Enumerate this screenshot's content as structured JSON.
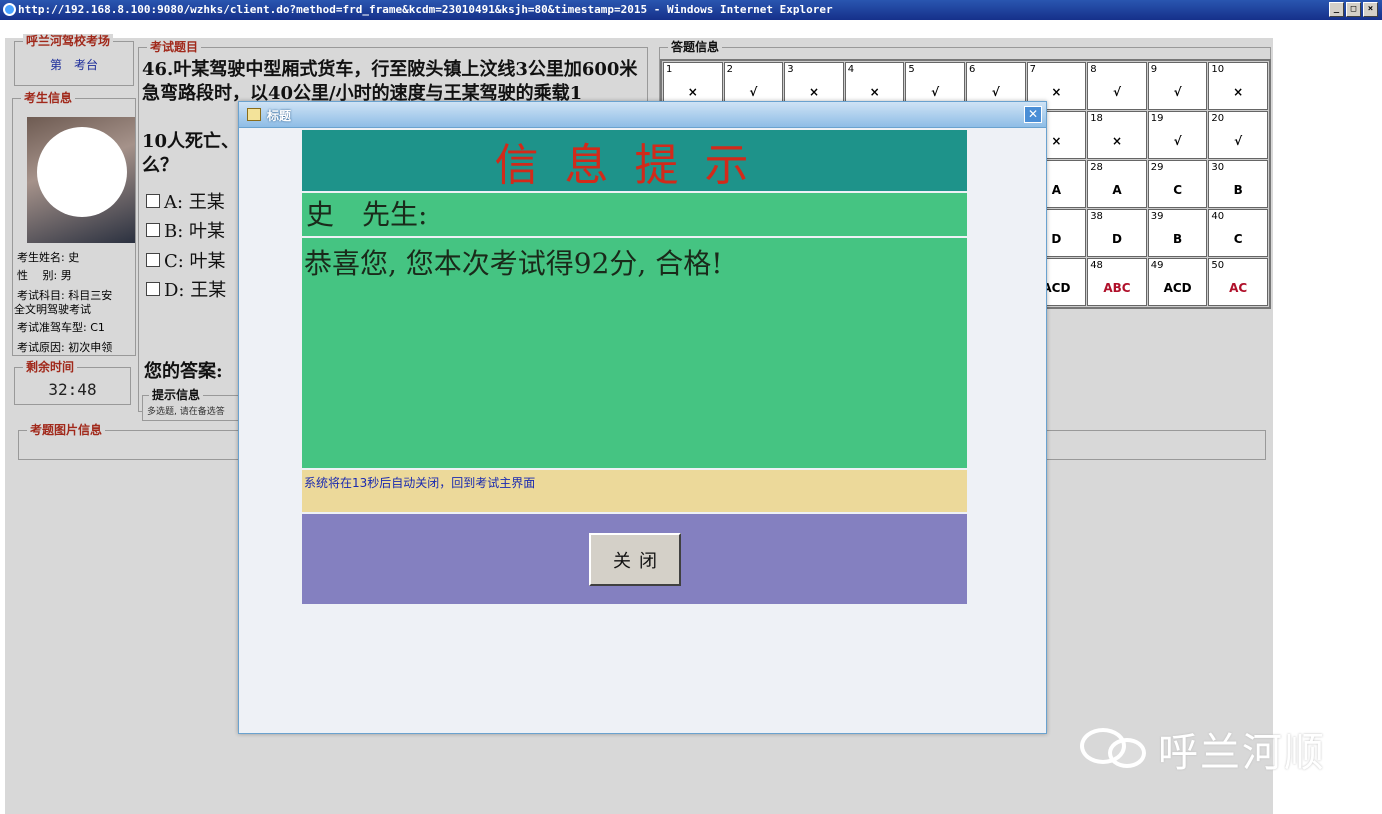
{
  "browser": {
    "title": "http://192.168.8.100:9080/wzhks/client.do?method=frd_frame&kcdm=23010491&ksjh=80&timestamp=2015 - Windows Internet Explorer"
  },
  "exam_site": {
    "legend": "呼兰河驾校考场",
    "prefix": "第",
    "suffix": "考台"
  },
  "candidate": {
    "legend": "考生信息",
    "name": "考生姓名: 史",
    "gender": "性　 别: 男",
    "subject_line1": "考试科目: 科目三安",
    "subject_line2": "全文明驾驶考试",
    "vehicle": "考试准驾车型: C1",
    "reason": "考试原因: 初次申领"
  },
  "timer": {
    "legend": "剩余时间",
    "value": "32:48"
  },
  "question": {
    "legend": "考试题目",
    "text": "46.叶某驾驶中型厢式货车，行至陂头镇上汶线3公里加600米急弯路段时，以40公里/小时的速度与王某驾驶的乘载1",
    "line3": "10人死亡、",
    "line4": "么？",
    "options": [
      "A: 王某",
      "B: 叶某",
      "C: 叶某",
      "D: 王某"
    ],
    "your_answer": "您的答案:"
  },
  "hint": {
    "legend": "提示信息",
    "text": "多选题, 请在备选答"
  },
  "picture": {
    "legend": "考题图片信息"
  },
  "answers": {
    "legend": "答题信息",
    "cells": [
      {
        "n": "1",
        "a": "×",
        "c": ""
      },
      {
        "n": "2",
        "a": "√",
        "c": ""
      },
      {
        "n": "3",
        "a": "×",
        "c": ""
      },
      {
        "n": "4",
        "a": "×",
        "c": ""
      },
      {
        "n": "5",
        "a": "√",
        "c": ""
      },
      {
        "n": "6",
        "a": "√",
        "c": ""
      },
      {
        "n": "7",
        "a": "×",
        "c": ""
      },
      {
        "n": "8",
        "a": "√",
        "c": ""
      },
      {
        "n": "9",
        "a": "√",
        "c": ""
      },
      {
        "n": "10",
        "a": "×",
        "c": ""
      },
      {
        "n": "",
        "a": "",
        "c": ""
      },
      {
        "n": "",
        "a": "",
        "c": ""
      },
      {
        "n": "",
        "a": "",
        "c": ""
      },
      {
        "n": "",
        "a": "",
        "c": ""
      },
      {
        "n": "",
        "a": "",
        "c": ""
      },
      {
        "n": "",
        "a": "",
        "c": ""
      },
      {
        "n": "",
        "a": "×",
        "c": ""
      },
      {
        "n": "18",
        "a": "×",
        "c": ""
      },
      {
        "n": "19",
        "a": "√",
        "c": ""
      },
      {
        "n": "20",
        "a": "√",
        "c": ""
      },
      {
        "n": "",
        "a": "",
        "c": ""
      },
      {
        "n": "",
        "a": "",
        "c": ""
      },
      {
        "n": "",
        "a": "",
        "c": ""
      },
      {
        "n": "",
        "a": "",
        "c": ""
      },
      {
        "n": "",
        "a": "",
        "c": ""
      },
      {
        "n": "",
        "a": "",
        "c": ""
      },
      {
        "n": "",
        "a": "A",
        "c": ""
      },
      {
        "n": "28",
        "a": "A",
        "c": ""
      },
      {
        "n": "29",
        "a": "C",
        "c": ""
      },
      {
        "n": "30",
        "a": "B",
        "c": ""
      },
      {
        "n": "",
        "a": "",
        "c": ""
      },
      {
        "n": "",
        "a": "",
        "c": ""
      },
      {
        "n": "",
        "a": "",
        "c": ""
      },
      {
        "n": "",
        "a": "",
        "c": ""
      },
      {
        "n": "",
        "a": "",
        "c": ""
      },
      {
        "n": "",
        "a": "",
        "c": ""
      },
      {
        "n": "",
        "a": "D",
        "c": ""
      },
      {
        "n": "38",
        "a": "D",
        "c": ""
      },
      {
        "n": "39",
        "a": "B",
        "c": ""
      },
      {
        "n": "40",
        "a": "C",
        "c": ""
      },
      {
        "n": "",
        "a": "",
        "c": ""
      },
      {
        "n": "",
        "a": "",
        "c": ""
      },
      {
        "n": "",
        "a": "",
        "c": ""
      },
      {
        "n": "",
        "a": "",
        "c": ""
      },
      {
        "n": "",
        "a": "",
        "c": ""
      },
      {
        "n": "",
        "a": "",
        "c": ""
      },
      {
        "n": "",
        "a": "ACD",
        "c": ""
      },
      {
        "n": "48",
        "a": "ABC",
        "c": "red"
      },
      {
        "n": "49",
        "a": "ACD",
        "c": ""
      },
      {
        "n": "50",
        "a": "AC",
        "c": "red"
      }
    ]
  },
  "modal": {
    "title": "标题",
    "heading": "信息提示",
    "name_line": "史　先生:",
    "result": "恭喜您, 您本次考试得92分, 合格!",
    "auto_close": "系统将在13秒后自动关闭，回到考试主界面",
    "close_label": "关闭",
    "colors": {
      "heading_bg": "#1e938a",
      "heading_text": "#d22a1a",
      "body_bg": "#45c482",
      "note_bg": "#ecd99a",
      "button_bg": "#8480c0"
    }
  },
  "watermark": {
    "text": "呼兰河顺"
  }
}
